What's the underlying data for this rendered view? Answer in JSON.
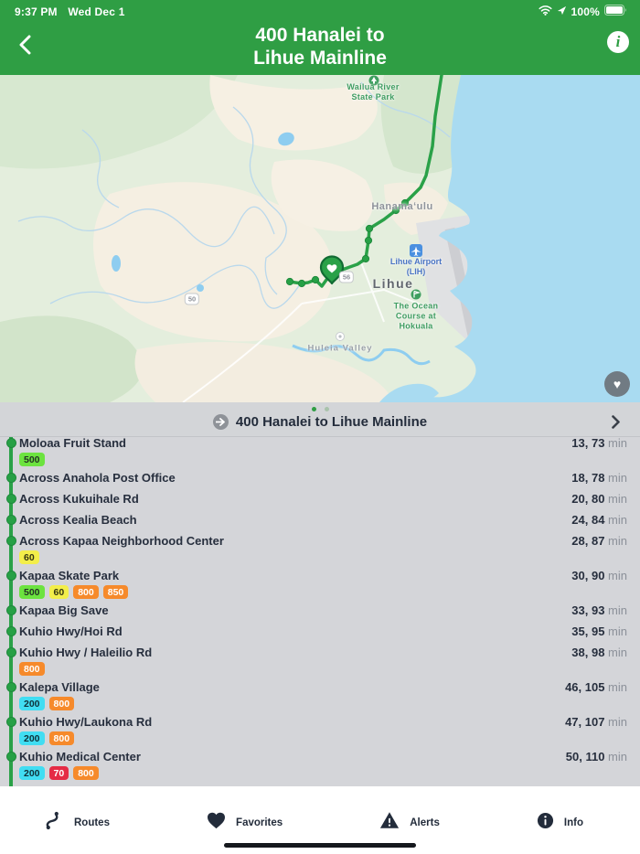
{
  "status_bar": {
    "time": "9:37 PM",
    "date": "Wed Dec 1",
    "battery_percent": "100%"
  },
  "header": {
    "title_line1": "400 Hanalei to",
    "title_line2": "Lihue Mainline"
  },
  "icons": {
    "info_glyph": "i",
    "heart_glyph": "♥"
  },
  "map": {
    "labels": {
      "state_park": "Wailua River\nState Park",
      "hanamaulu": "Hanamaʻulu",
      "airport": "Lihue Airport\n(LIH)",
      "lihue": "Lihue",
      "golf_course": "The Ocean\nCourse at\nHokuala",
      "huleia": "Huleia Valley",
      "shield_50": "50",
      "shield_56": "56"
    }
  },
  "route_bar": {
    "title": "400 Hanalei to Lihue Mainline"
  },
  "stop_list": {
    "unit": "min",
    "stops": [
      {
        "name": "Moloaa Fruit Stand",
        "badges": [
          "500"
        ],
        "time": "13, 73"
      },
      {
        "name": "Across Anahola Post Office",
        "badges": [],
        "time": "18, 78"
      },
      {
        "name": "Across Kukuihale Rd",
        "badges": [],
        "time": "20, 80"
      },
      {
        "name": "Across Kealia Beach",
        "badges": [],
        "time": "24, 84"
      },
      {
        "name": "Across Kapaa Neighborhood Center",
        "badges": [
          "60"
        ],
        "time": "28, 87"
      },
      {
        "name": "Kapaa Skate Park",
        "badges": [
          "500",
          "60",
          "800",
          "850"
        ],
        "time": "30, 90"
      },
      {
        "name": "Kapaa Big Save",
        "badges": [],
        "time": "33, 93"
      },
      {
        "name": "Kuhio Hwy/Hoi Rd",
        "badges": [],
        "time": "35, 95"
      },
      {
        "name": "Kuhio Hwy / Haleilio Rd",
        "badges": [
          "800"
        ],
        "time": "38, 98"
      },
      {
        "name": "Kalepa Village",
        "badges": [
          "200",
          "800"
        ],
        "time": "46, 105"
      },
      {
        "name": "Kuhio Hwy/Laukona Rd",
        "badges": [
          "200",
          "800"
        ],
        "time": "47, 107"
      },
      {
        "name": "Kuhio Medical Center",
        "badges": [
          "200",
          "70",
          "800"
        ],
        "time": "50, 110"
      }
    ]
  },
  "badge_styles": {
    "500": {
      "bg": "#6ce33f",
      "fg": "#233224"
    },
    "60": {
      "bg": "#f3ee4a",
      "fg": "#343511"
    },
    "800": {
      "bg": "#f68a2b",
      "fg": "#ffffff"
    },
    "850": {
      "bg": "#f68a2b",
      "fg": "#ffffff"
    },
    "200": {
      "bg": "#41ddf2",
      "fg": "#0e3038"
    },
    "70": {
      "bg": "#e52b45",
      "fg": "#ffffff"
    }
  },
  "colors": {
    "header_green": "#2f9e44",
    "route_green": "#2aa148",
    "ocean": "#a9dbf1"
  },
  "tab_bar": {
    "items": [
      {
        "label": "Routes"
      },
      {
        "label": "Favorites"
      },
      {
        "label": "Alerts"
      },
      {
        "label": "Info"
      }
    ]
  }
}
